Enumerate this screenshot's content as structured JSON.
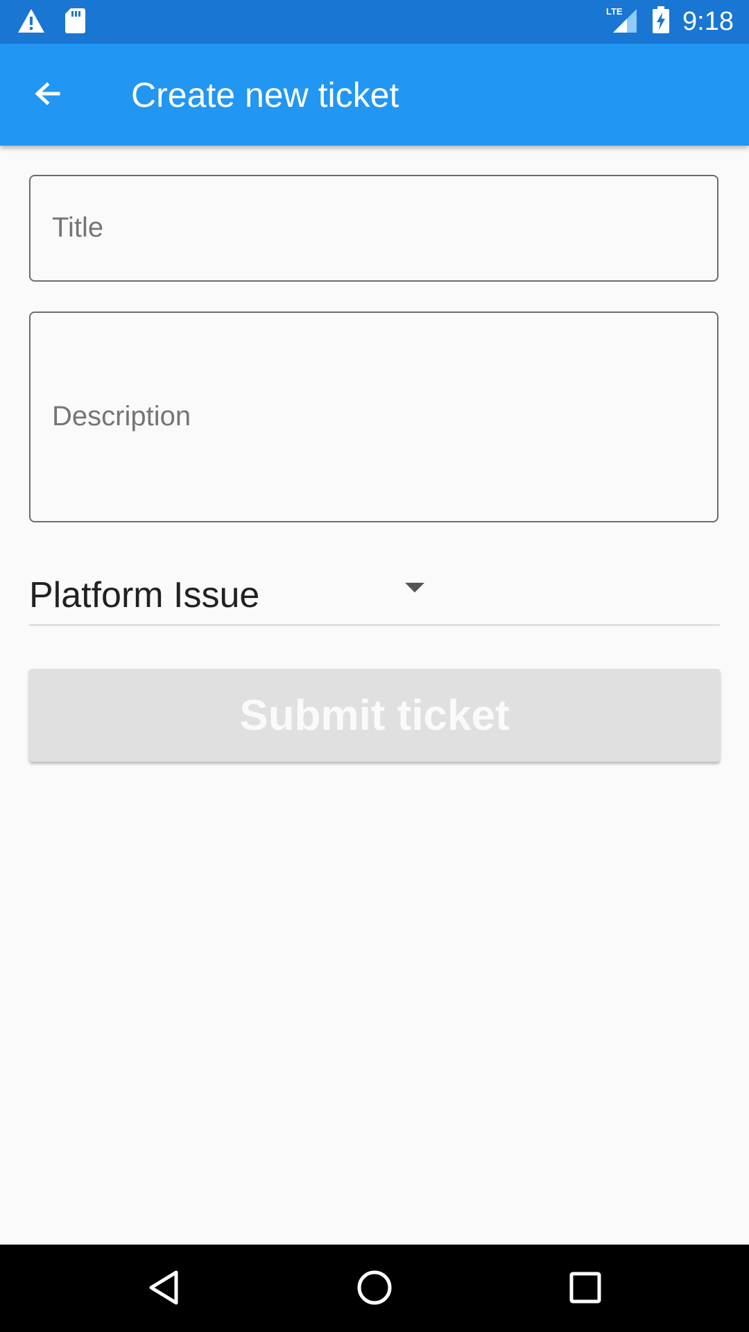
{
  "status_bar": {
    "time": "9:18",
    "network": "LTE",
    "icons": [
      "warning-icon",
      "sd-card-icon",
      "lte-signal-icon",
      "battery-charging-icon"
    ]
  },
  "app_bar": {
    "title": "Create new ticket",
    "back_icon": "arrow-back-icon"
  },
  "form": {
    "title_label": "Title",
    "description_label": "Description",
    "category": {
      "selected": "Platform Issue"
    },
    "submit_label": "Submit ticket"
  },
  "nav_bar": {
    "icons": [
      "nav-back-icon",
      "nav-home-icon",
      "nav-recents-icon"
    ]
  },
  "colors": {
    "status_bar": "#1976d2",
    "app_bar": "#2196f3",
    "background": "#fafafa",
    "button_disabled": "#e0e0e0"
  }
}
